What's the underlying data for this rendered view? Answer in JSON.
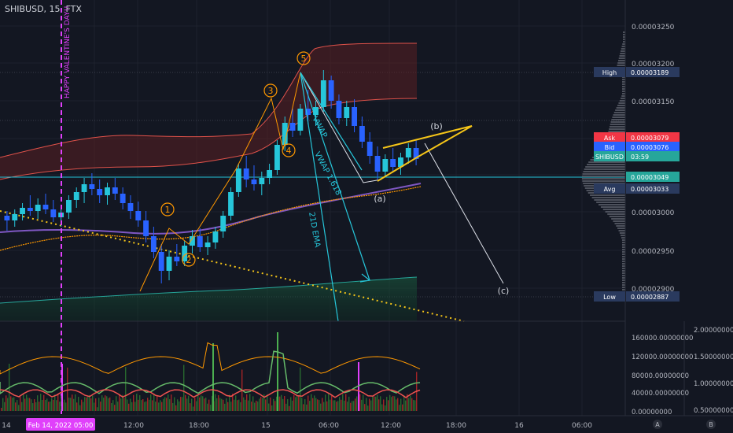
{
  "header": {
    "symbol": "SHIBUSD, 15, FTX"
  },
  "chart_data": {
    "type": "candlestick",
    "price_axis": {
      "ticks": [
        "0.00003250",
        "0.00003200",
        "0.00003150",
        "0.00003100",
        "0.00003050",
        "0.00003000",
        "0.00002950",
        "0.00002900"
      ],
      "range": [
        2.86e-05,
        3.275e-05
      ]
    },
    "price_labels": [
      {
        "tag": "High",
        "value": "0.00003189",
        "color": "#2a3a5e"
      },
      {
        "tag": "Ask",
        "value": "0.00003079",
        "color": "#f23645"
      },
      {
        "tag": "Bid",
        "value": "0.00003076",
        "color": "#2962ff"
      },
      {
        "tag": "SHIBUSD",
        "value": "03:59",
        "color": "#26a69a"
      },
      {
        "tag": "",
        "value": "0.00003049",
        "color": "#26a69a"
      },
      {
        "tag": "Avg",
        "value": "0.00003033",
        "color": "#2a3a5e"
      },
      {
        "tag": "Low",
        "value": "0.00002887",
        "color": "#2a3a5e"
      }
    ],
    "time_axis": {
      "labels": [
        "14",
        "12:00",
        "18:00",
        "15",
        "06:00",
        "12:00",
        "18:00",
        "16",
        "06:00"
      ],
      "highlight": "Feb 14, 2022  05:00"
    },
    "vertical_marker": "HAPPY VALENTINE'S DAY!!",
    "wave_labels": [
      "1",
      "2",
      "3",
      "4",
      "5",
      "(a)",
      "(b)",
      "(c)"
    ],
    "line_labels": [
      "VWAP",
      "VWAP 1.618",
      "21D EMA"
    ],
    "candles": [
      [
        3.004,
        3.01,
        2.985,
        2.998
      ],
      [
        2.998,
        3.012,
        2.99,
        3.006
      ],
      [
        3.006,
        3.02,
        2.998,
        3.014
      ],
      [
        3.014,
        3.03,
        3.004,
        3.01
      ],
      [
        3.01,
        3.026,
        3.0,
        3.018
      ],
      [
        3.018,
        3.032,
        3.006,
        3.012
      ],
      [
        3.012,
        3.024,
        2.996,
        3.002
      ],
      [
        3.002,
        3.016,
        2.99,
        3.008
      ],
      [
        3.008,
        3.03,
        3.0,
        3.024
      ],
      [
        3.024,
        3.04,
        3.014,
        3.034
      ],
      [
        3.034,
        3.052,
        3.02,
        3.044
      ],
      [
        3.044,
        3.058,
        3.03,
        3.038
      ],
      [
        3.038,
        3.05,
        3.02,
        3.03
      ],
      [
        3.03,
        3.046,
        3.018,
        3.04
      ],
      [
        3.04,
        3.052,
        3.024,
        3.032
      ],
      [
        3.032,
        3.04,
        3.012,
        3.02
      ],
      [
        3.02,
        3.03,
        3.0,
        3.01
      ],
      [
        3.01,
        3.022,
        2.99,
        2.998
      ],
      [
        2.998,
        3.01,
        2.97,
        2.978
      ],
      [
        2.978,
        2.99,
        2.95,
        2.958
      ],
      [
        2.958,
        2.968,
        2.918,
        2.934
      ],
      [
        2.934,
        2.96,
        2.922,
        2.952
      ],
      [
        2.952,
        2.968,
        2.94,
        2.946
      ],
      [
        2.946,
        2.972,
        2.94,
        2.966
      ],
      [
        2.966,
        2.986,
        2.956,
        2.978
      ],
      [
        2.978,
        2.988,
        2.958,
        2.964
      ],
      [
        2.964,
        2.978,
        2.954,
        2.97
      ],
      [
        2.97,
        2.99,
        2.962,
        2.984
      ],
      [
        2.984,
        3.01,
        2.976,
        3.004
      ],
      [
        3.004,
        3.04,
        2.998,
        3.034
      ],
      [
        3.034,
        3.07,
        3.028,
        3.064
      ],
      [
        3.064,
        3.08,
        3.04,
        3.05
      ],
      [
        3.05,
        3.068,
        3.036,
        3.044
      ],
      [
        3.044,
        3.06,
        3.03,
        3.052
      ],
      [
        3.052,
        3.07,
        3.044,
        3.062
      ],
      [
        3.062,
        3.1,
        3.056,
        3.094
      ],
      [
        3.094,
        3.13,
        3.086,
        3.122
      ],
      [
        3.122,
        3.14,
        3.104,
        3.112
      ],
      [
        3.112,
        3.146,
        3.106,
        3.14
      ],
      [
        3.14,
        3.164,
        3.12,
        3.132
      ],
      [
        3.132,
        3.15,
        3.118,
        3.142
      ],
      [
        3.142,
        3.189,
        3.136,
        3.176
      ],
      [
        3.176,
        3.182,
        3.14,
        3.15
      ],
      [
        3.15,
        3.158,
        3.12,
        3.128
      ],
      [
        3.128,
        3.15,
        3.118,
        3.142
      ],
      [
        3.142,
        3.152,
        3.11,
        3.118
      ],
      [
        3.118,
        3.13,
        3.09,
        3.098
      ],
      [
        3.098,
        3.11,
        3.07,
        3.08
      ],
      [
        3.08,
        3.092,
        3.05,
        3.06
      ],
      [
        3.06,
        3.082,
        3.054,
        3.076
      ],
      [
        3.076,
        3.09,
        3.06,
        3.066
      ],
      [
        3.066,
        3.084,
        3.056,
        3.078
      ],
      [
        3.078,
        3.096,
        3.07,
        3.09
      ],
      [
        3.09,
        3.1,
        3.068,
        3.076
      ]
    ],
    "volume_axis": {
      "ticks": [
        "160000.00000000",
        "120000.00000000",
        "80000.00000000",
        "40000.00000000",
        "0.00000000"
      ]
    },
    "oscillator_axis": {
      "ticks": [
        "2.00000000",
        "1.50000000",
        "1.00000000",
        "0.50000000"
      ]
    },
    "bottom_badges": [
      "A",
      "B"
    ]
  }
}
